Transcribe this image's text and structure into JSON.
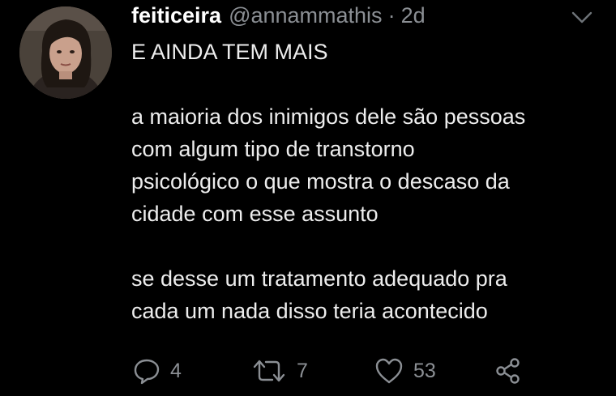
{
  "tweet": {
    "display_name": "feiticeira",
    "handle": "@annammathis",
    "separator": "·",
    "time": "2d",
    "paragraphs": [
      [
        "E AINDA TEM MAIS"
      ],
      [
        "a maioria dos inimigos dele são pessoas",
        "com algum tipo de transtorno",
        "psicológico o que mostra o descaso da",
        "cidade com esse assunto"
      ],
      [
        "se desse um tratamento adequado pra",
        "cada um nada disso teria acontecido"
      ]
    ]
  },
  "actions": {
    "reply_count": "4",
    "retweet_count": "7",
    "like_count": "53"
  },
  "icons": {
    "menu": "chevron-down-icon",
    "reply": "reply-icon",
    "retweet": "retweet-icon",
    "like": "heart-icon",
    "share": "share-icon"
  },
  "colors": {
    "background": "#000000",
    "text": "#e7e9ea",
    "muted": "#8b8f94"
  }
}
